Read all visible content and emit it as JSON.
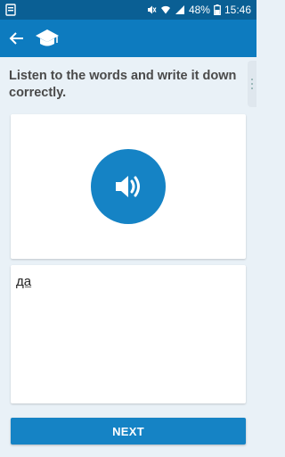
{
  "status_bar": {
    "battery": "48%",
    "time": "15:46",
    "icons": [
      "notification-icon",
      "mute-icon",
      "wifi-icon",
      "signal-icon",
      "battery-icon"
    ]
  },
  "app_bar": {
    "icons": [
      "back-arrow-icon",
      "graduation-cap-icon"
    ]
  },
  "instruction": "Listen to the words and write it down correctly.",
  "audio_card": {
    "icon": "speaker-icon"
  },
  "answer": {
    "value": "да"
  },
  "next_button": {
    "label": "NEXT"
  },
  "colors": {
    "status_bar": "#0a5f94",
    "app_bar": "#0d7bbf",
    "accent": "#1583c5",
    "background": "#e9f1f7"
  }
}
